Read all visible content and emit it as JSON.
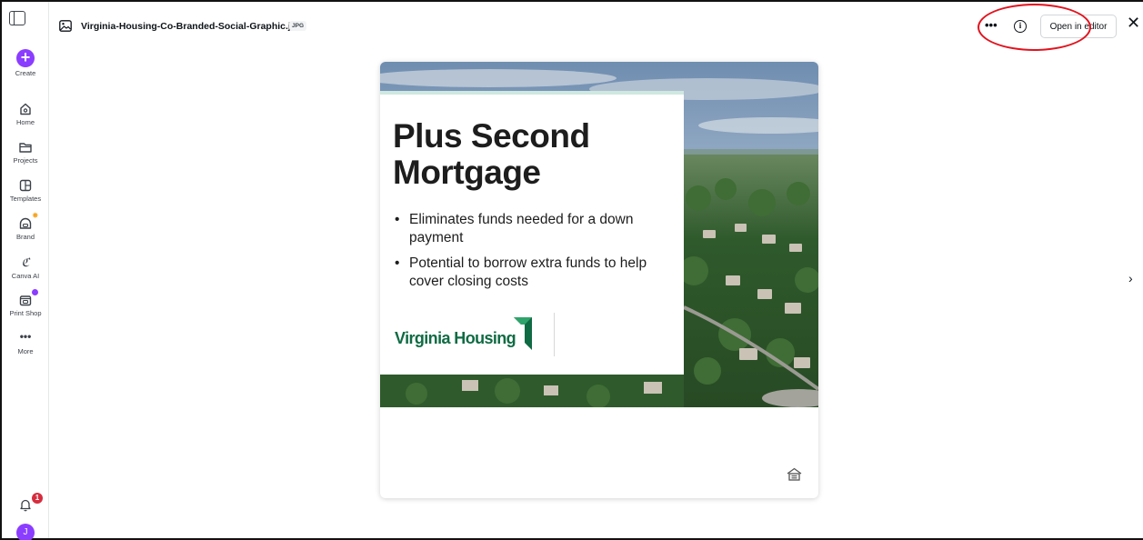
{
  "sidebar": {
    "create_label": "Create",
    "items": [
      {
        "label": "Home",
        "icon": "home-icon"
      },
      {
        "label": "Projects",
        "icon": "folder-icon"
      },
      {
        "label": "Templates",
        "icon": "templates-icon"
      },
      {
        "label": "Brand",
        "icon": "brand-icon"
      },
      {
        "label": "Canva AI",
        "icon": "canva-ai-icon"
      },
      {
        "label": "Print Shop",
        "icon": "print-shop-icon"
      },
      {
        "label": "More",
        "icon": "more-dots-icon"
      }
    ],
    "notification_count": "1",
    "avatar_initial": "J",
    "accent_color": "#8b3dff",
    "badge_color": "#d62d3e"
  },
  "header": {
    "file_name": "Virginia-Housing-Co-Branded-Social-Graphic.jpg",
    "file_type": "JPG",
    "more_label": "•••",
    "info_label": "i",
    "open_editor_label": "Open in editor",
    "close_label": "✕"
  },
  "preview": {
    "headline_line1": "Plus Second",
    "headline_line2": "Mortgage",
    "bullets": [
      "Eliminates funds needed for a down payment",
      "Potential to borrow extra funds to help cover closing costs"
    ],
    "brand_name": "Virginia Housing",
    "brand_color": "#0f6b43"
  },
  "nav": {
    "next_label": "›"
  }
}
